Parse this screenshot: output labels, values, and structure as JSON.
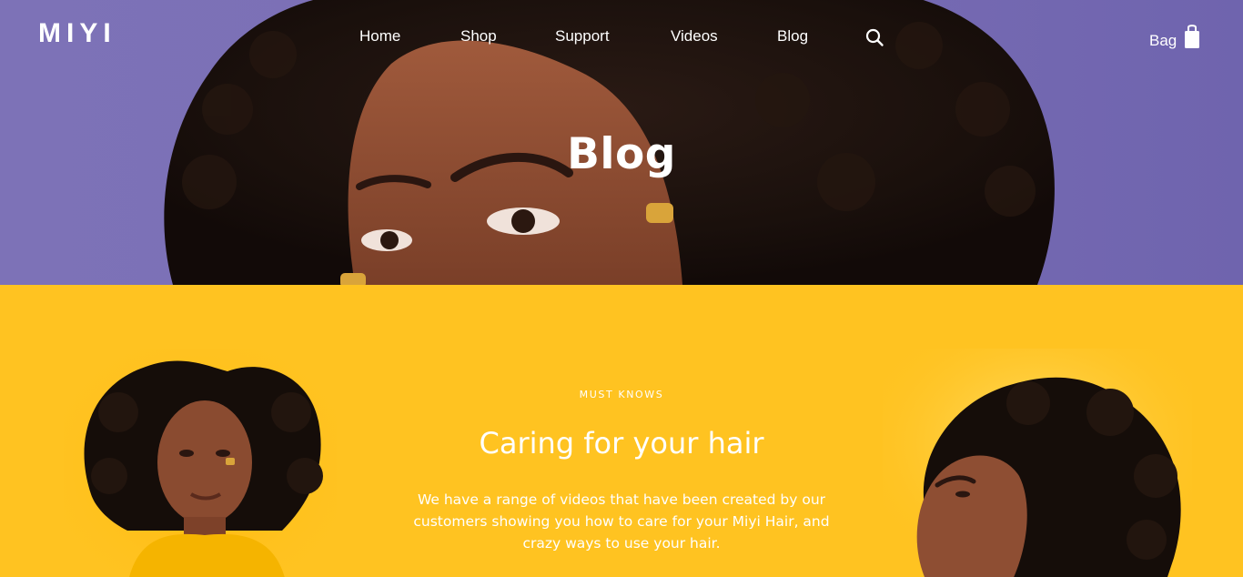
{
  "brand": {
    "name": "MIYI"
  },
  "nav": {
    "items": [
      {
        "label": "Home"
      },
      {
        "label": "Shop"
      },
      {
        "label": "Support"
      },
      {
        "label": "Videos"
      },
      {
        "label": "Blog"
      }
    ],
    "search_icon": "search-icon",
    "bag_label": "Bag",
    "bag_icon": "shopping-bag-icon"
  },
  "hero": {
    "title": "Blog",
    "background_color": "#7b6fb6"
  },
  "feature": {
    "eyebrow": "MUST KNOWS",
    "heading": "Caring for your hair",
    "body": "We have a range of videos that have been created by our customers showing you how to care for your Miyi Hair, and crazy ways to use your hair.",
    "background_color": "#ffc321"
  }
}
